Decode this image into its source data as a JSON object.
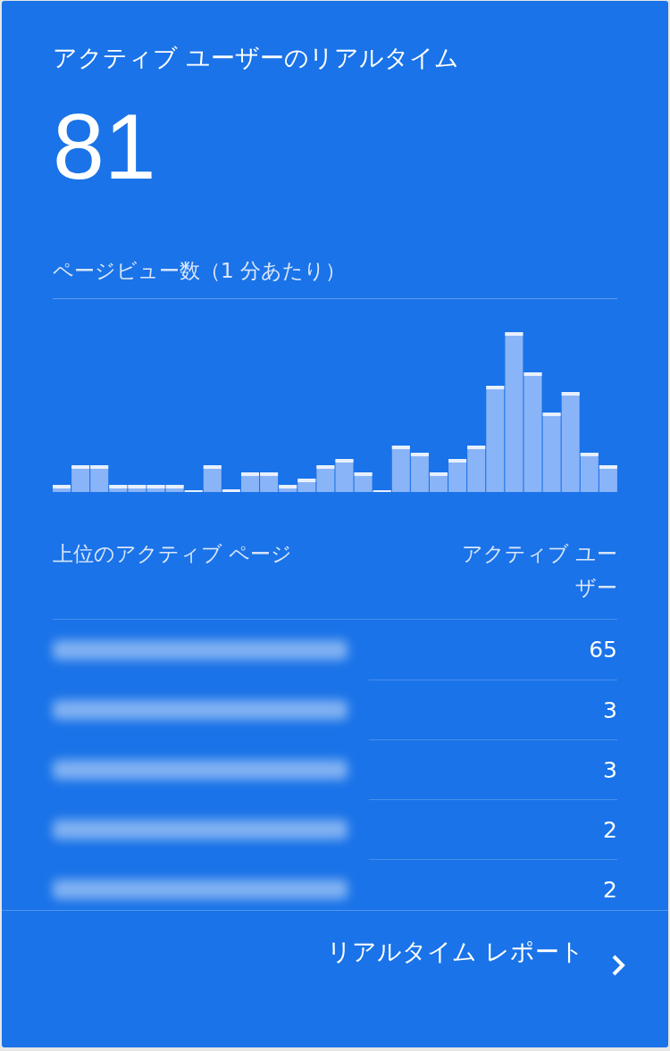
{
  "card": {
    "title": "アクティブ ユーザーのリアルタイム",
    "active_users": "81"
  },
  "pageviews": {
    "title": "ページビュー数（1 分あたり）"
  },
  "table": {
    "columns": [
      "上位のアクティブ ページ",
      "アクティブ ユーザー"
    ],
    "rows": [
      {
        "value": "65"
      },
      {
        "value": "3"
      },
      {
        "value": "3"
      },
      {
        "value": "2"
      },
      {
        "value": "2"
      }
    ]
  },
  "footer": {
    "link": "リアルタイム レポート"
  }
}
